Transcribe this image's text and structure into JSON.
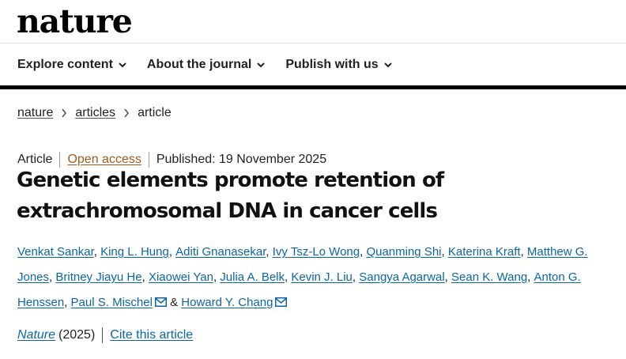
{
  "site": {
    "logo": "nature"
  },
  "nav": {
    "items": [
      {
        "label": "Explore content"
      },
      {
        "label": "About the journal"
      },
      {
        "label": "Publish with us"
      }
    ]
  },
  "breadcrumb": {
    "items": [
      {
        "label": "nature"
      },
      {
        "label": "articles"
      }
    ],
    "current": "article"
  },
  "article": {
    "type": "Article",
    "access": "Open access",
    "published": "Published: 19 November 2025",
    "title": "Genetic elements promote retention of extrachromosomal DNA in cancer cells",
    "authors": [
      "Venkat Sankar",
      "King L. Hung",
      "Aditi Gnanasekar",
      "Ivy Tsz-Lo Wong",
      "Quanming Shi",
      "Katerina Kraft",
      "Matthew G. Jones",
      "Britney Jiayu He",
      "Xiaowei Yan",
      "Julia A. Belk",
      "Kevin J. Liu",
      "Sangya Agarwal",
      "Sean K. Wang",
      "Anton G. Henssen",
      "Paul S. Mischel",
      "Howard Y. Chang"
    ],
    "author_separator": ", ",
    "author_conjunction": " & ",
    "journal": "Nature",
    "year": "(2025)",
    "cite_label": "Cite this article"
  },
  "colors": {
    "link": "#0a66a8",
    "open_access": "#a25a1c",
    "text": "#222222"
  }
}
